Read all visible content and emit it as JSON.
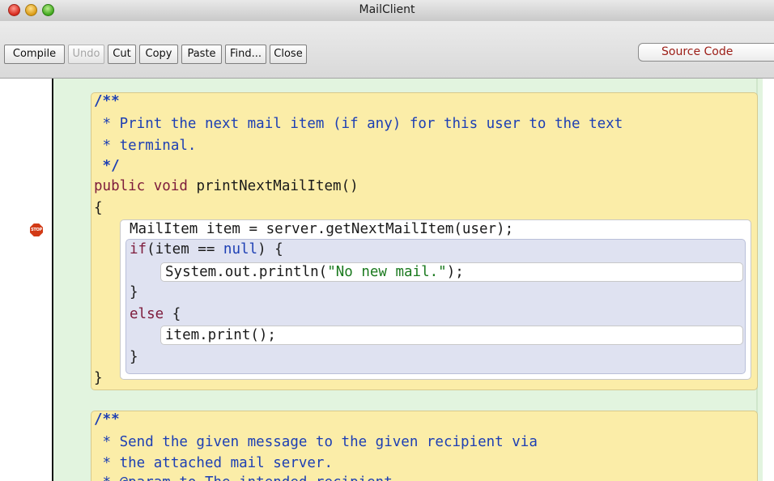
{
  "window": {
    "title": "MailClient"
  },
  "toolbar": {
    "compile": "Compile",
    "undo": "Undo",
    "cut": "Cut",
    "copy": "Copy",
    "paste": "Paste",
    "find": "Find...",
    "close": "Close",
    "view_select": "Source Code"
  },
  "gutter": {
    "breakpoint_label": "STOP"
  },
  "code": {
    "doc1_open": "/**",
    "doc1_l1": " * Print the next mail item (if any) for this user to the text",
    "doc1_l2": " * terminal.",
    "doc1_close": " */",
    "sig_kw1": "public",
    "sig_kw2": "void",
    "sig_rest": "printNextMailItem()",
    "brace_open": "{",
    "stmt1": "MailItem item = server.getNextMailItem(user);",
    "if_kw": "if",
    "if_cond_a": "(item == ",
    "if_null": "null",
    "if_cond_b": ") {",
    "println_a": "System.out.println(",
    "println_str": "\"No new mail.\"",
    "println_b": ");",
    "if_close": "}",
    "else_kw": "else",
    "else_brace": "{",
    "print_stmt": "item.print();",
    "else_close": "}",
    "method_close": "}",
    "doc2_open": "/**",
    "doc2_l1": " * Send the given message to the given recipient via",
    "doc2_l2": " * the attached mail server.",
    "doc2_l3": " * @param to The intended recipient."
  },
  "colors": {
    "comment": "#1d3fb4",
    "keyword": "#7d1b3b",
    "string": "#1b7a1f",
    "class_scope": "#fbeda8",
    "method_scope": "#ffffff",
    "if_scope": "#dfe2f1",
    "gutter_green": "#e2f4df"
  }
}
